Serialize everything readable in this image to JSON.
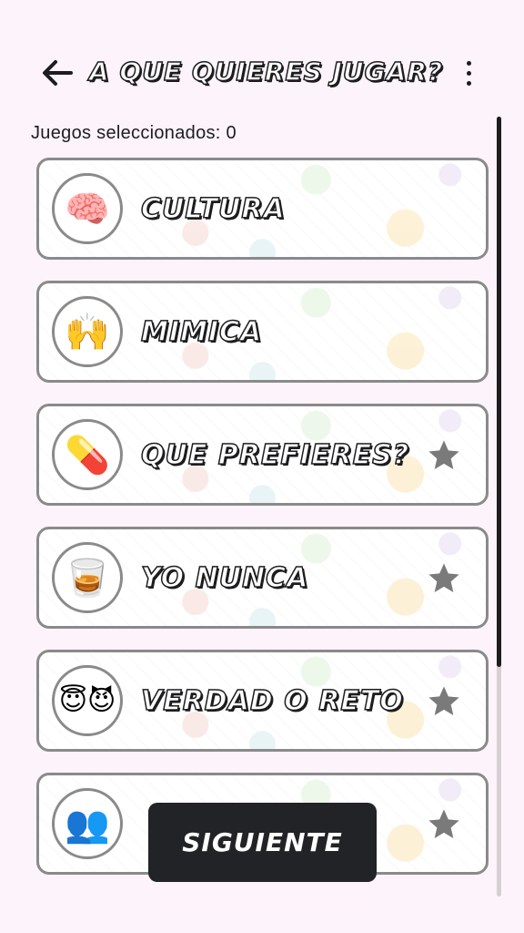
{
  "header": {
    "title": "A QUE QUIERES JUGAR?",
    "back_icon": "arrow-left-icon",
    "menu_icon": "more-vertical-icon"
  },
  "selection": {
    "label": "Juegos seleccionados: 0"
  },
  "games": [
    {
      "label": "CULTURA",
      "icon": "brain-icon",
      "glyph": "🧠",
      "starred": false
    },
    {
      "label": "MIMICA",
      "icon": "raised-hands-icon",
      "glyph": "🙌",
      "starred": false
    },
    {
      "label": "QUE PREFIERES?",
      "icon": "pills-icon",
      "glyph": "💊",
      "starred": true
    },
    {
      "label": "YO NUNCA",
      "icon": "drink-glass-icon",
      "glyph": "🥃",
      "starred": true
    },
    {
      "label": "VERDAD O RETO",
      "icon": "angel-devil-icon",
      "glyph": "😇😈",
      "starred": true
    },
    {
      "label": "",
      "icon": "crowd-icon",
      "glyph": "👥",
      "starred": true
    }
  ],
  "footer": {
    "next_label": "SIGUIENTE"
  },
  "colors": {
    "background": "#fcf3fb",
    "button": "#222326",
    "card_border": "#8a8a8a",
    "star": "#7a7a7a"
  }
}
